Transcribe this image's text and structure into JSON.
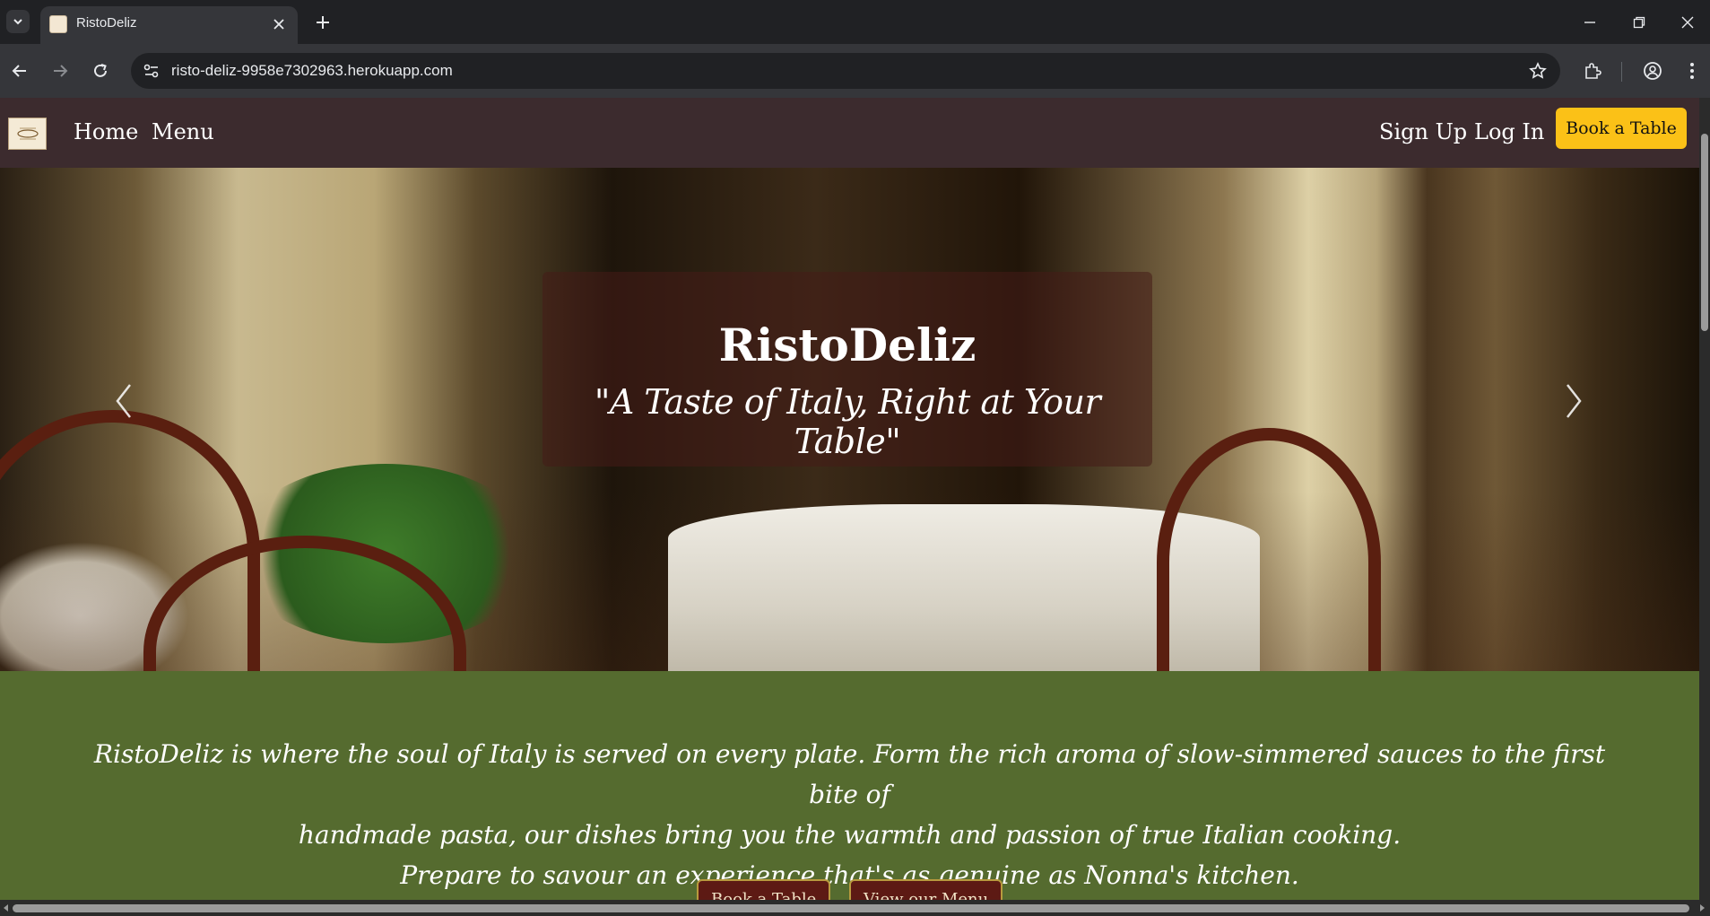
{
  "browser": {
    "tab_title": "RistoDeliz",
    "url": "risto-deliz-9958e7302963.herokuapp.com",
    "icons": [
      "tab-search-icon",
      "close-icon",
      "plus-icon",
      "minimize-icon",
      "restore-icon",
      "window-close-icon",
      "back-arrow-icon",
      "forward-arrow-icon",
      "reload-icon",
      "site-info-icon",
      "bookmark-star-icon",
      "extensions-icon",
      "profile-icon",
      "more-vert-icon"
    ]
  },
  "navbar": {
    "links": [
      "Home",
      "Menu"
    ],
    "right_links": [
      "Sign Up",
      "Log In"
    ],
    "book_button": "Book a Table"
  },
  "hero": {
    "title": "RistoDeliz",
    "subtitle": "\"A Taste of Italy, Right at Your Table\""
  },
  "intro": {
    "line1": "RistoDeliz is where the soul of Italy is served on every plate. Form the rich aroma of slow-simmered sauces to the first bite of",
    "line2": "handmade pasta, our dishes bring you the warmth and passion of true Italian cooking.",
    "line3": "Prepare to savour an experience that's as genuine as Nonna's kitchen.",
    "cta_book": "Book a Table",
    "cta_menu": "View our Menu"
  },
  "colors": {
    "navbar_bg": "#3c2b2e",
    "accent": "#fbc117",
    "intro_bg": "#556b2f",
    "cta_bg": "#5d1a14"
  }
}
